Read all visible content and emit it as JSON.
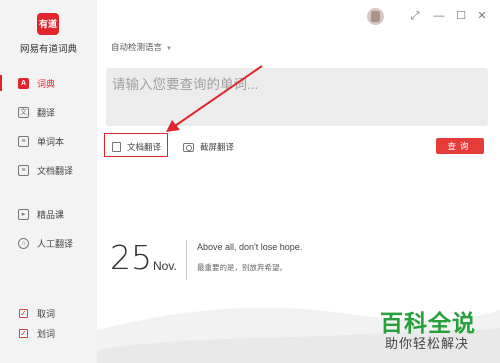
{
  "app": {
    "logo_text": "有道",
    "name": "网易有道词典"
  },
  "sidebar": {
    "items": [
      {
        "label": "词典",
        "icon": "dictionary-icon",
        "active": true
      },
      {
        "label": "翻译",
        "icon": "translate-icon",
        "active": false
      },
      {
        "label": "单词本",
        "icon": "wordbook-icon",
        "active": false
      },
      {
        "label": "文档翻译",
        "icon": "document-icon",
        "active": false
      },
      {
        "label": "精品课",
        "icon": "course-icon",
        "active": false
      },
      {
        "label": "人工翻译",
        "icon": "human-translate-icon",
        "active": false
      }
    ],
    "checks": [
      {
        "label": "取词",
        "checked": true
      },
      {
        "label": "划词",
        "checked": true
      }
    ]
  },
  "toolbar": {
    "language": "自动检测语言"
  },
  "search": {
    "placeholder": "请输入您要查询的单词..."
  },
  "tools": {
    "doc_translate": "文档翻译",
    "screenshot_translate": "截屏翻译",
    "search_button": "查询"
  },
  "daily": {
    "day": "25",
    "month": "Nov.",
    "quote_en": "Above all, don't lose hope.",
    "quote_cn": "最重要的是，别放弃希望。"
  },
  "watermark": {
    "title": "百科全说",
    "subtitle": "助你轻松解决"
  },
  "colors": {
    "accent": "#e0262c",
    "watermark": "#26a03a"
  }
}
